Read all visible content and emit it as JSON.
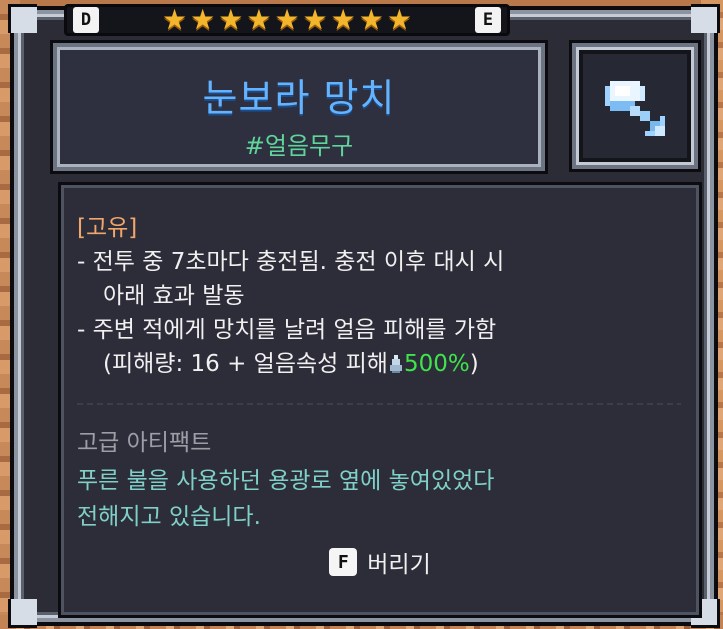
{
  "rank": {
    "left_grade": "D",
    "right_grade": "E",
    "stars_count": 9,
    "star_glyph": "★"
  },
  "item": {
    "name": "눈보라 망치",
    "tag": "#얼음무구",
    "icon": "ice-hammer-icon"
  },
  "description": {
    "unique_label": "[고유]",
    "line1": "- 전투 중 7초마다 충전됨. 충전 이후 대시 시",
    "line2": "아래 효과 발동",
    "line3": "- 주변 적에게 망치를 날려 얼음 피해를 가함",
    "line4_prefix": "(피해량: 16 + 얼음속성 피해",
    "line4_value": "500%",
    "line4_suffix": ")"
  },
  "grade": "고급 아티팩트",
  "flavor": {
    "line1": "푸른 불을 사용하던 용광로 옆에 놓여있었다",
    "line2": "전해지고 있습니다."
  },
  "action": {
    "key": "F",
    "label": "버리기"
  },
  "colors": {
    "name": "#63b3ff",
    "tag": "#5fd59a",
    "unique": "#f2a66b",
    "percent": "#3fe34c",
    "flavor": "#7fd0c8",
    "grade": "#9c9ea6",
    "star": "#f3b52b"
  }
}
